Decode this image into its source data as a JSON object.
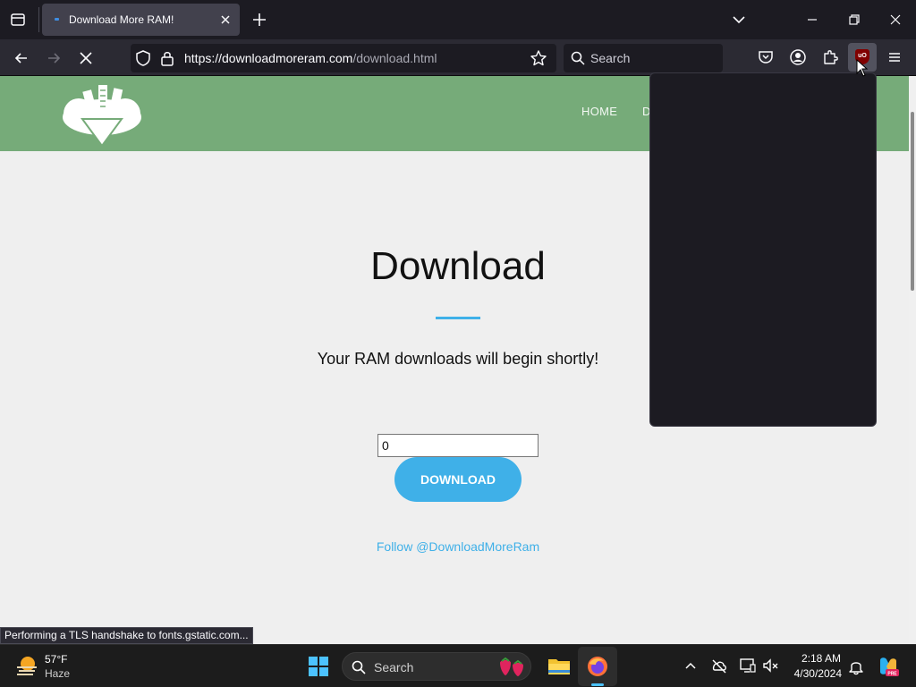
{
  "browser": {
    "tab_title": "Download More RAM!",
    "url_host": "https://downloadmoreram.com",
    "url_path": "/download.html",
    "search_placeholder": "Search",
    "status_text": "Performing a TLS handshake to fonts.gstatic.com...",
    "extension_badge": "uO"
  },
  "site": {
    "nav": {
      "home": "HOME",
      "download_partial": "D"
    },
    "heading": "Download",
    "subtext": "Your RAM downloads will begin shortly!",
    "amount_value": "0",
    "download_button": "DOWNLOAD",
    "follow_link": "Follow @DownloadMoreRam",
    "colors": {
      "header": "#76ab79",
      "accent": "#3fb0e8"
    }
  },
  "taskbar": {
    "weather_temp": "57°F",
    "weather_condition": "Haze",
    "search_placeholder": "Search",
    "time": "2:18 AM",
    "date": "4/30/2024"
  }
}
